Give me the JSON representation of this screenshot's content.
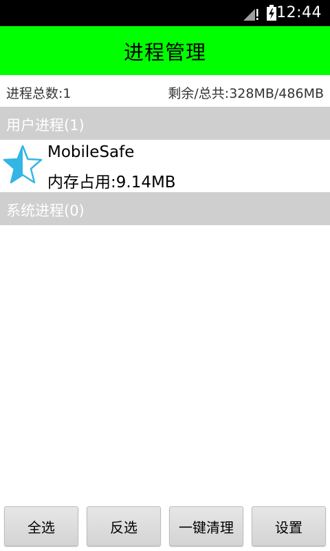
{
  "status_bar": {
    "time": "12:44",
    "icons": [
      "signal-icon",
      "battery-charging-icon"
    ]
  },
  "header": {
    "title": "进程管理"
  },
  "summary": {
    "process_count": "进程总数:1",
    "memory": "剩余/总共:328MB/486MB"
  },
  "sections": {
    "user": {
      "label": "用户进程(1)",
      "items": [
        {
          "name": "MobileSafe",
          "memory": "内存占用:9.14MB",
          "icon": "star-icon"
        }
      ]
    },
    "system": {
      "label": "系统进程(0)"
    }
  },
  "buttons": {
    "select_all": "全选",
    "invert": "反选",
    "clean": "一键清理",
    "settings": "设置"
  },
  "colors": {
    "title_bar": "#00ff00",
    "section_header": "#cfcfcf",
    "status_bar": "#000000",
    "icon": "#33b5e5"
  }
}
